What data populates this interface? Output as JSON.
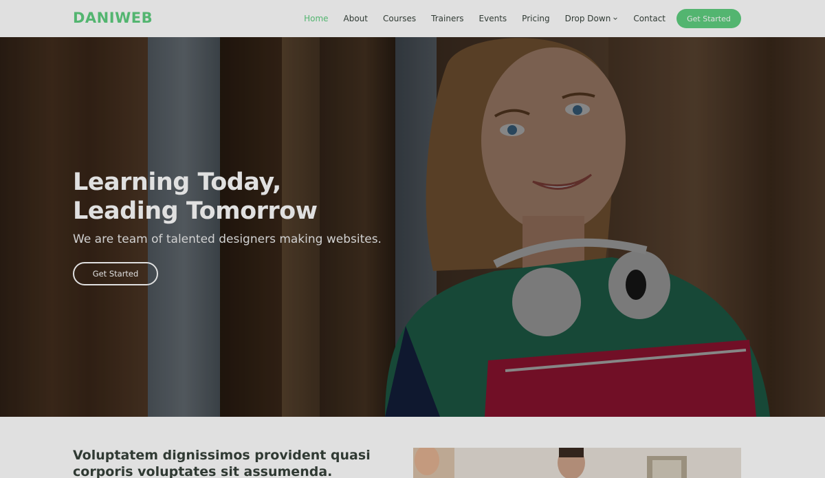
{
  "brand": {
    "name": "DANIWEB",
    "color": "#5fcf80"
  },
  "nav": {
    "items": [
      {
        "label": "Home",
        "active": true
      },
      {
        "label": "About",
        "active": false
      },
      {
        "label": "Courses",
        "active": false
      },
      {
        "label": "Trainers",
        "active": false
      },
      {
        "label": "Events",
        "active": false
      },
      {
        "label": "Pricing",
        "active": false
      },
      {
        "label": "Drop Down",
        "active": false,
        "icon": "chevron-down-icon"
      },
      {
        "label": "Contact",
        "active": false
      }
    ],
    "cta_label": "Get Started"
  },
  "hero": {
    "title_line1": "Learning Today,",
    "title_line2": "Leading Tomorrow",
    "subtitle": "We are team of talented designers making websites.",
    "button_label": "Get Started"
  },
  "about": {
    "heading": "Voluptatem dignissimos provident quasi corporis voluptates sit assumenda."
  }
}
